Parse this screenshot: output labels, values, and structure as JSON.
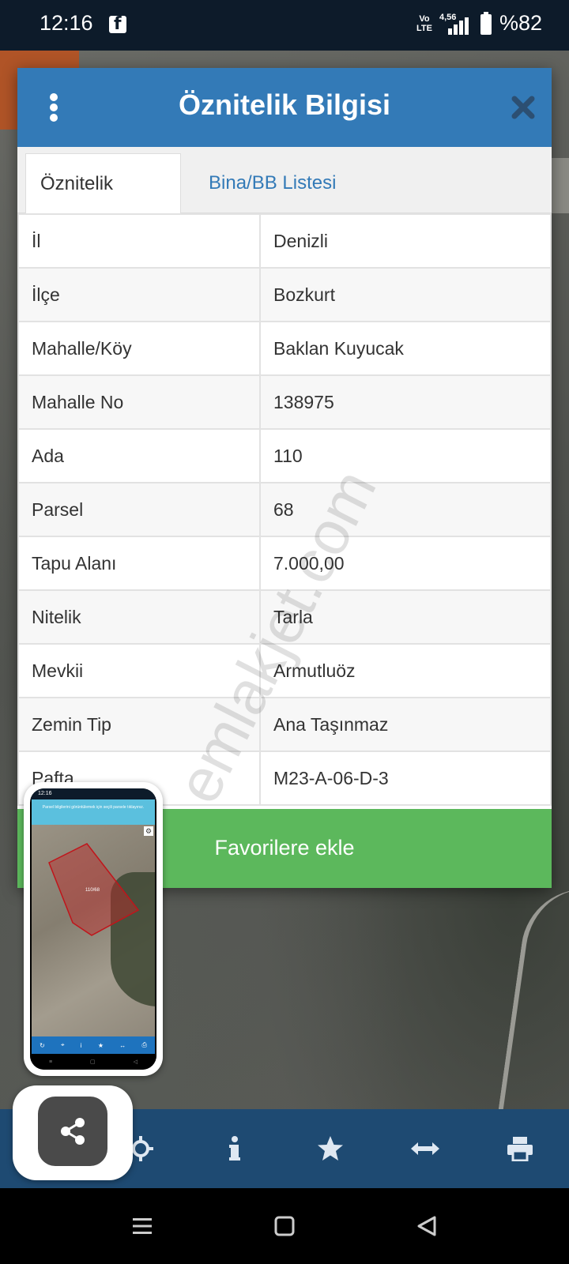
{
  "status_bar": {
    "time": "12:16",
    "volte": "Vo LTE",
    "network": "4,56",
    "battery": "%82"
  },
  "dialog": {
    "title": "Öznitelik Bilgisi",
    "menu_icon": "more-vertical-icon",
    "close_icon": "close-icon",
    "tabs": [
      {
        "label": "Öznitelik Bilgisi",
        "active": true
      },
      {
        "label": "Bina/BB Listesi",
        "active": false
      }
    ],
    "rows": [
      {
        "key": "İl",
        "value": "Denizli"
      },
      {
        "key": "İlçe",
        "value": "Bozkurt"
      },
      {
        "key": "Mahalle/Köy",
        "value": "Baklan Kuyucak"
      },
      {
        "key": "Mahalle No",
        "value": "138975"
      },
      {
        "key": "Ada",
        "value": "110"
      },
      {
        "key": "Parsel",
        "value": "68"
      },
      {
        "key": "Tapu Alanı",
        "value": "7.000,00"
      },
      {
        "key": "Nitelik",
        "value": "Tarla"
      },
      {
        "key": "Mevkii",
        "value": "Armutluöz"
      },
      {
        "key": "Zemin Tip",
        "value": "Ana Taşınmaz"
      },
      {
        "key": "Pafta",
        "value": "M23-A-06-D-3"
      }
    ],
    "favorite_button": "Favorilere ekle"
  },
  "toolbar": {
    "icons": [
      "locate-icon",
      "info-icon",
      "star-icon",
      "measure-icon",
      "print-icon"
    ]
  },
  "preview": {
    "time": "12:16",
    "banner": "Parsel bilgilerini görüntülemek için seçili parsele tıklayınız.",
    "parcel_label": "110/68"
  },
  "share": {
    "icon": "share-icon"
  },
  "watermark": "emlakjet.com",
  "colors": {
    "header_blue": "#337ab7",
    "favorite_green": "#5cb85c",
    "toolbar_blue": "#1e4a72",
    "status_bar": "#0d1b2a"
  }
}
